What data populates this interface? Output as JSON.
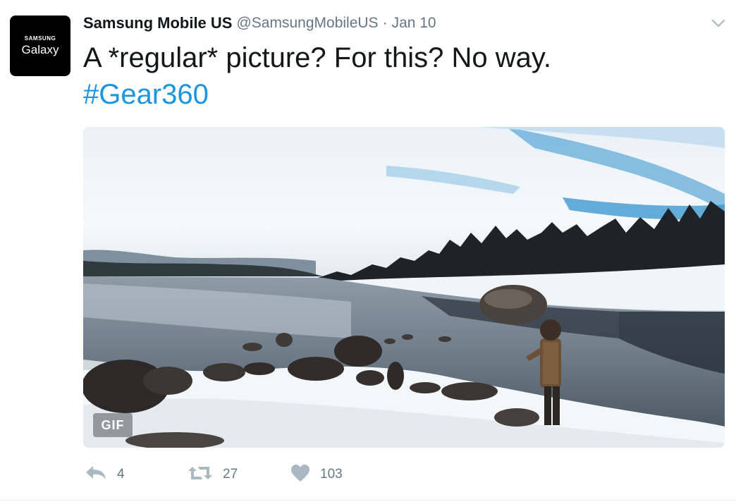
{
  "author": {
    "display_name": "Samsung Mobile US",
    "handle": "@SamsungMobileUS",
    "separator": "·",
    "timestamp": "Jan 10",
    "avatar_brand_top": "SAMSUNG",
    "avatar_brand_bottom": "Galaxy"
  },
  "tweet": {
    "text": "A *regular* picture? For this? No way.",
    "hashtag": "#Gear360"
  },
  "media": {
    "type": "gif",
    "badge_label": "GIF",
    "description_icon": "winter-lake-scene"
  },
  "actions": {
    "reply": {
      "icon": "reply-icon",
      "count": "4"
    },
    "retweet": {
      "icon": "retweet-icon",
      "count": "27"
    },
    "like": {
      "icon": "heart-icon",
      "count": "103"
    }
  },
  "colors": {
    "link": "#1b95e0",
    "name": "#14171a",
    "meta": "#657786",
    "icon": "#aab8c2"
  }
}
